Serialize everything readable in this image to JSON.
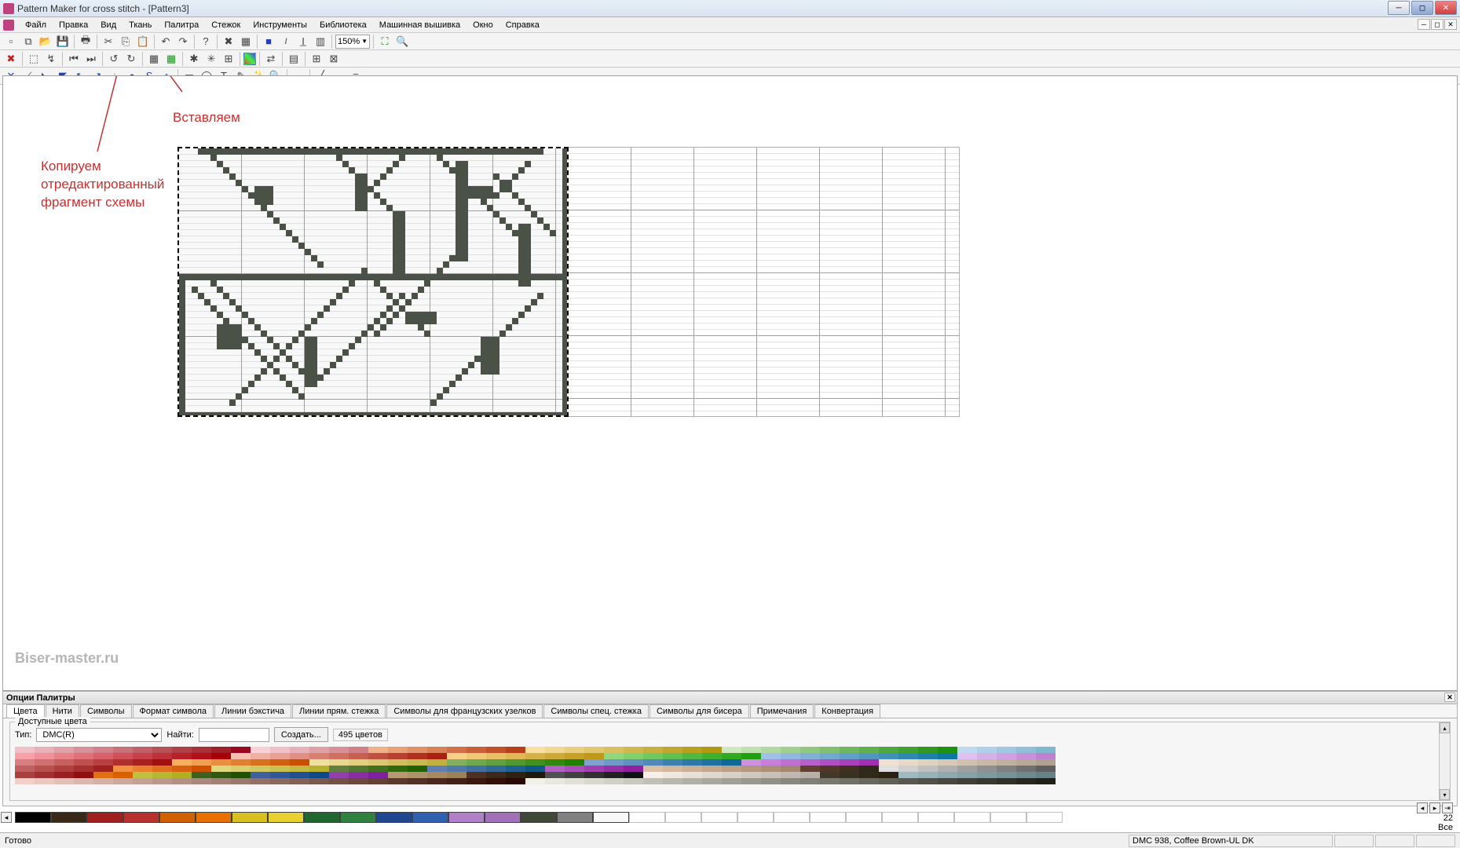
{
  "window": {
    "title": "Pattern Maker for cross stitch - [Pattern3]"
  },
  "menu": [
    "Файл",
    "Правка",
    "Вид",
    "Ткань",
    "Палитра",
    "Стежок",
    "Инструменты",
    "Библиотека",
    "Машинная вышивка",
    "Окно",
    "Справка"
  ],
  "toolbar1": {
    "zoom": "150%"
  },
  "annotations": {
    "copy": "Копируем отредактированный фрагмент схемы",
    "paste": "Вставляем"
  },
  "palette": {
    "title": "Опции Палитры",
    "tabs": [
      "Цвета",
      "Нити",
      "Символы",
      "Формат символа",
      "Линии бэкстича",
      "Линии прям. стежка",
      "Символы для французских узелков",
      "Символы спец. стежка",
      "Символы для бисера",
      "Примечания",
      "Конвертация"
    ],
    "group": "Доступные цвета",
    "type_label": "Тип:",
    "type_value": "DMC(R)",
    "find_label": "Найти:",
    "find_value": "",
    "create_label": "Создать...",
    "count": "495 цветов",
    "right_count": "22",
    "right_all": "Все"
  },
  "used_colors": [
    "#000000",
    "#3a2818",
    "#a02020",
    "#b83030",
    "#d06000",
    "#e87000",
    "#d8c020",
    "#e8d030",
    "#206830",
    "#308040",
    "#204890",
    "#3060b0",
    "#b080c8",
    "#a070b8",
    "#404838",
    "#808080",
    "#f8f8f8"
  ],
  "status": {
    "ready": "Готово",
    "info": "DMC  938, Coffee Brown-UL DK"
  },
  "watermark": "Biser-master.ru",
  "swatch_colors": [
    [
      "#f0c0c8",
      "#e8b0b8",
      "#e0a0a8",
      "#d89098",
      "#d08088",
      "#c87078",
      "#c06068",
      "#b85058",
      "#b04048",
      "#a83038",
      "#a02028",
      "#980820",
      "#f8d0d8",
      "#f0c0c8",
      "#e8b0b8",
      "#e0a0a8",
      "#d89098",
      "#d08088",
      "#f0b088",
      "#e8a078",
      "#e09068",
      "#d88058",
      "#d07048",
      "#c86038",
      "#c05028",
      "#b84018",
      "#f8e0a0",
      "#f0d890",
      "#e8d080",
      "#e0c870",
      "#d8c060",
      "#d0b850",
      "#c8b040",
      "#c0a830",
      "#b8a020",
      "#b09810",
      "#d0e8c0",
      "#c0e0b0",
      "#b0d8a0",
      "#a0d090",
      "#90c880",
      "#80c070",
      "#70b860",
      "#60b050",
      "#50a840",
      "#40a030",
      "#309820",
      "#209010",
      "#c0d8f0",
      "#b0d0e8",
      "#a0c8e0",
      "#90c0d8",
      "#80b8d0"
    ],
    [
      "#f8a0a8",
      "#f09098",
      "#e88088",
      "#e07078",
      "#d86068",
      "#d05058",
      "#c84048",
      "#c03038",
      "#b82028",
      "#b01018",
      "#a80008",
      "#f8c0b0",
      "#f0b0a0",
      "#e8a090",
      "#e09080",
      "#d88070",
      "#d07060",
      "#c86050",
      "#c05040",
      "#b84030",
      "#b03020",
      "#a82010",
      "#f8d088",
      "#f0c878",
      "#e8c068",
      "#e0b858",
      "#d8b048",
      "#d0a838",
      "#c8a028",
      "#c09818",
      "#90d880",
      "#80d070",
      "#70c860",
      "#60c050",
      "#50b840",
      "#40b030",
      "#30a820",
      "#20a010",
      "#a0c0e8",
      "#90b8e0",
      "#80b0d8",
      "#70a8d0",
      "#60a0c8",
      "#5098c0",
      "#4090b8",
      "#3088b0",
      "#2080a8",
      "#1078a0",
      "#e0c0f0",
      "#d8b0e8",
      "#d0a0e0",
      "#c890d8",
      "#c080d0"
    ],
    [
      "#d88080",
      "#d07070",
      "#c86060",
      "#c05050",
      "#b84040",
      "#b03030",
      "#a82020",
      "#a01010",
      "#f8b060",
      "#f0a050",
      "#e89040",
      "#e08030",
      "#d87020",
      "#d06010",
      "#c85000",
      "#f0e0a0",
      "#e8d890",
      "#e0d080",
      "#d8c870",
      "#d0c060",
      "#c8b850",
      "#c0b040",
      "#80b060",
      "#70a850",
      "#60a040",
      "#509830",
      "#409020",
      "#308810",
      "#208000",
      "#80a0d0",
      "#7098c8",
      "#6090c0",
      "#5088b8",
      "#4080b0",
      "#3078a8",
      "#2070a0",
      "#106898",
      "#d090e0",
      "#c880d8",
      "#c070d0",
      "#b860c8",
      "#b050c0",
      "#a840b8",
      "#a030b0",
      "#f0e0d0",
      "#e8d8c8",
      "#e0d0c0",
      "#d8c8b8",
      "#d0c0b0",
      "#c8b8a8",
      "#c0b0a0",
      "#b8a898",
      "#b0a090"
    ],
    [
      "#c06060",
      "#b85050",
      "#b04040",
      "#a83030",
      "#a02020",
      "#f09040",
      "#e88030",
      "#e07020",
      "#d86010",
      "#d05000",
      "#e0d880",
      "#d8d070",
      "#d0c860",
      "#c8c050",
      "#c0b840",
      "#b8b030",
      "#608040",
      "#507830",
      "#407020",
      "#306810",
      "#206000",
      "#6080b0",
      "#5078a8",
      "#4070a0",
      "#306898",
      "#206090",
      "#105888",
      "#b060c0",
      "#a850b8",
      "#a040b0",
      "#9830a8",
      "#9020a0",
      "#d8c0a8",
      "#d0b8a0",
      "#c8b098",
      "#c0a890",
      "#b8a088",
      "#b09880",
      "#a89078",
      "#a08870",
      "#604030",
      "#503828",
      "#403020",
      "#302818",
      "#e0e0e0",
      "#d0d0d0",
      "#c0c0c0",
      "#b0b0b0",
      "#a0a0a0",
      "#909090",
      "#808080",
      "#707070",
      "#606060"
    ],
    [
      "#a84040",
      "#a03030",
      "#982020",
      "#901010",
      "#e07010",
      "#d86000",
      "#c0c040",
      "#b8b830",
      "#b0b020",
      "#406020",
      "#305810",
      "#205000",
      "#4060a0",
      "#305898",
      "#205090",
      "#104888",
      "#9040a8",
      "#8830a0",
      "#8020a0",
      "#b89870",
      "#b09068",
      "#a88860",
      "#a08058",
      "#503020",
      "#402818",
      "#302010",
      "#201808",
      "#505050",
      "#404040",
      "#303030",
      "#202020",
      "#101010",
      "#f8f0e8",
      "#f0e8e0",
      "#e8e0d8",
      "#e0d8d0",
      "#d8d0c8",
      "#d0c8c0",
      "#c8c0b8",
      "#c0b8b0",
      "#b8b0a8",
      "#403828",
      "#383020",
      "#302818",
      "#282010",
      "#a0b8c0",
      "#98b0b8",
      "#90a8b0",
      "#88a0a8",
      "#8098a0",
      "#789098",
      "#708890",
      "#688088"
    ],
    [
      "#f0d0c8",
      "#e8c8c0",
      "#e0c0b8",
      "#d8b8b0",
      "#d0b0a8",
      "#c8a8a0",
      "#c0a098",
      "#b89890",
      "#b09088",
      "#a88880",
      "#a08078",
      "#987870",
      "#907068",
      "#886860",
      "#806058",
      "#785850",
      "#705048",
      "#684840",
      "#604038",
      "#583830",
      "#503028",
      "#482820",
      "#402018",
      "#381810",
      "#301008",
      "#280800",
      "#f0f0e8",
      "#e8e8e0",
      "#e0e0d8",
      "#d8d8d0",
      "#d0d0c8",
      "#c8c8c0",
      "#c0c0b8",
      "#b8b8b0",
      "#b0b0a8",
      "#a8a8a0",
      "#a0a098",
      "#989890",
      "#909088",
      "#888880",
      "#808078",
      "#787870",
      "#707068",
      "#686860",
      "#606058",
      "#585850",
      "#505048",
      "#484840",
      "#404038",
      "#383830",
      "#303028",
      "#282820",
      "#202018"
    ]
  ]
}
